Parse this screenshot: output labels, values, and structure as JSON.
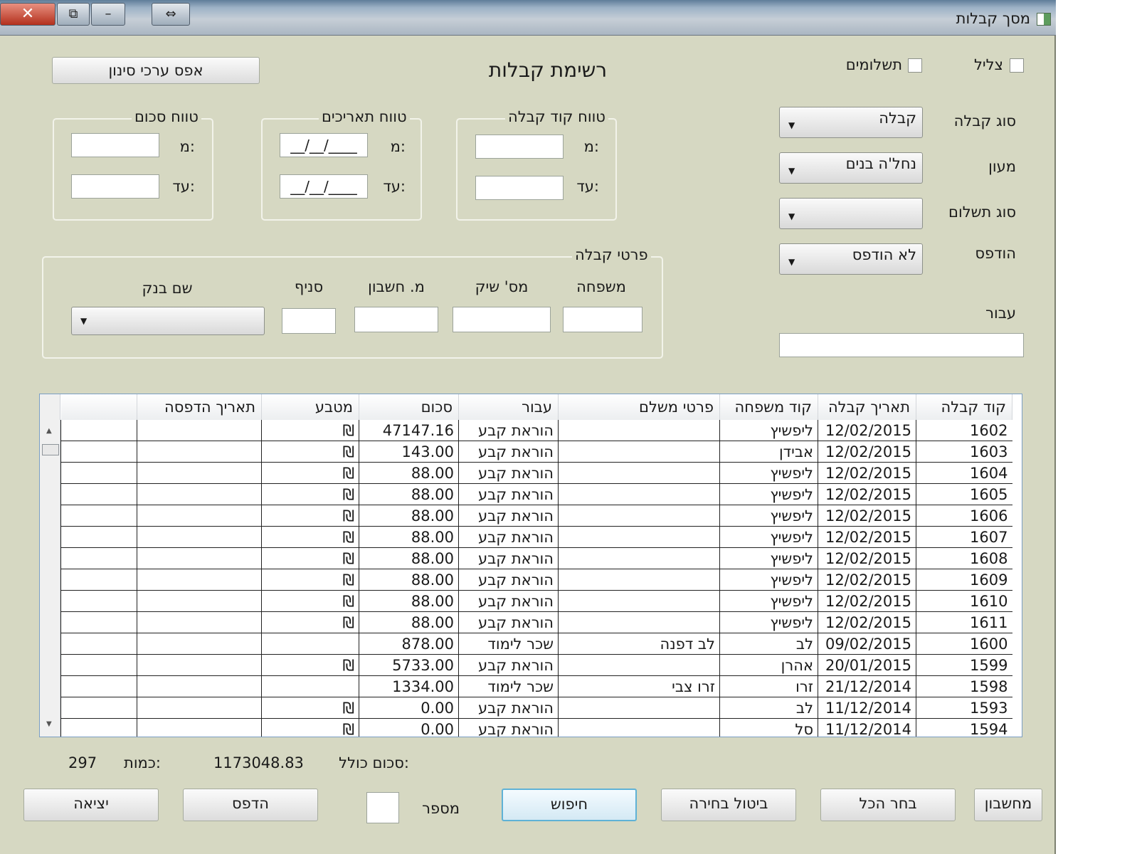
{
  "window": {
    "title": "מסך קבלות",
    "controls": {
      "close": "✕",
      "restore": "⧉",
      "minimize": "–",
      "resize": "⇔"
    }
  },
  "header": {
    "title": "רשימת קבלות",
    "reset_filters": "אפס ערכי סינון"
  },
  "checkboxes": {
    "tzlil": "צליל",
    "payments": "תשלומים"
  },
  "filters": {
    "receipt_type_label": "סוג קבלה",
    "receipt_type_value": "קבלה",
    "maon_label": "מעון",
    "maon_value": "נחל'ה בנים",
    "payment_type_label": "סוג תשלום",
    "payment_type_value": "",
    "printed_label": "הודפס",
    "printed_value": "לא הודפס",
    "for_label": "עבור"
  },
  "ranges": {
    "code_title": "טווח קוד קבלה",
    "dates_title": "טווח תאריכים",
    "sum_title": "טווח סכום",
    "from": "מ:",
    "to": "עד:",
    "date_mask": "__/__/____"
  },
  "details": {
    "title": "פרטי קבלה",
    "family": "משפחה",
    "check_no": "מס' שיק",
    "account_no": "מ. חשבון",
    "branch": "סניף",
    "bank_name": "שם בנק"
  },
  "grid": {
    "columns": [
      "קוד קבלה",
      "תאריך קבלה",
      "קוד משפחה",
      "פרטי משלם",
      "עבור",
      "סכום",
      "מטבע",
      "תאריך הדפסה",
      ""
    ],
    "rows": [
      [
        "1602",
        "12/02/2015",
        "ליפשיץ",
        "",
        "הוראת קבע",
        "47147.16",
        "₪",
        "",
        ""
      ],
      [
        "1603",
        "12/02/2015",
        "אבידן",
        "",
        "הוראת קבע",
        "143.00",
        "₪",
        "",
        ""
      ],
      [
        "1604",
        "12/02/2015",
        "ליפשיץ",
        "",
        "הוראת קבע",
        "88.00",
        "₪",
        "",
        ""
      ],
      [
        "1605",
        "12/02/2015",
        "ליפשיץ",
        "",
        "הוראת קבע",
        "88.00",
        "₪",
        "",
        ""
      ],
      [
        "1606",
        "12/02/2015",
        "ליפשיץ",
        "",
        "הוראת קבע",
        "88.00",
        "₪",
        "",
        ""
      ],
      [
        "1607",
        "12/02/2015",
        "ליפשיץ",
        "",
        "הוראת קבע",
        "88.00",
        "₪",
        "",
        ""
      ],
      [
        "1608",
        "12/02/2015",
        "ליפשיץ",
        "",
        "הוראת קבע",
        "88.00",
        "₪",
        "",
        ""
      ],
      [
        "1609",
        "12/02/2015",
        "ליפשיץ",
        "",
        "הוראת קבע",
        "88.00",
        "₪",
        "",
        ""
      ],
      [
        "1610",
        "12/02/2015",
        "ליפשיץ",
        "",
        "הוראת קבע",
        "88.00",
        "₪",
        "",
        ""
      ],
      [
        "1611",
        "12/02/2015",
        "ליפשיץ",
        "",
        "הוראת קבע",
        "88.00",
        "₪",
        "",
        ""
      ],
      [
        "1600",
        "09/02/2015",
        "לב",
        "לב דפנה",
        "שכר לימוד",
        "878.00",
        "",
        "",
        ""
      ],
      [
        "1599",
        "20/01/2015",
        "אהרן",
        "",
        "הוראת קבע",
        "5733.00",
        "₪",
        "",
        ""
      ],
      [
        "1598",
        "21/12/2014",
        "זרו",
        "זרו צבי",
        "שכר לימוד",
        "1334.00",
        "",
        "",
        ""
      ],
      [
        "1593",
        "11/12/2014",
        "לב",
        "",
        "הוראת קבע",
        "0.00",
        "₪",
        "",
        ""
      ],
      [
        "1594",
        "11/12/2014",
        "סל",
        "",
        "הוראת קבע",
        "0.00",
        "₪",
        "",
        ""
      ]
    ]
  },
  "footer": {
    "total_label": "סכום כולל:",
    "total_value": "1173048.83",
    "count_label": "כמות:",
    "count_value": "297",
    "number_label": "מספר"
  },
  "buttons": {
    "calculator": "מחשבון",
    "select_all": "בחר הכל",
    "cancel_selection": "ביטול בחירה",
    "search": "חיפוש",
    "print": "הדפס",
    "exit": "יציאה"
  }
}
